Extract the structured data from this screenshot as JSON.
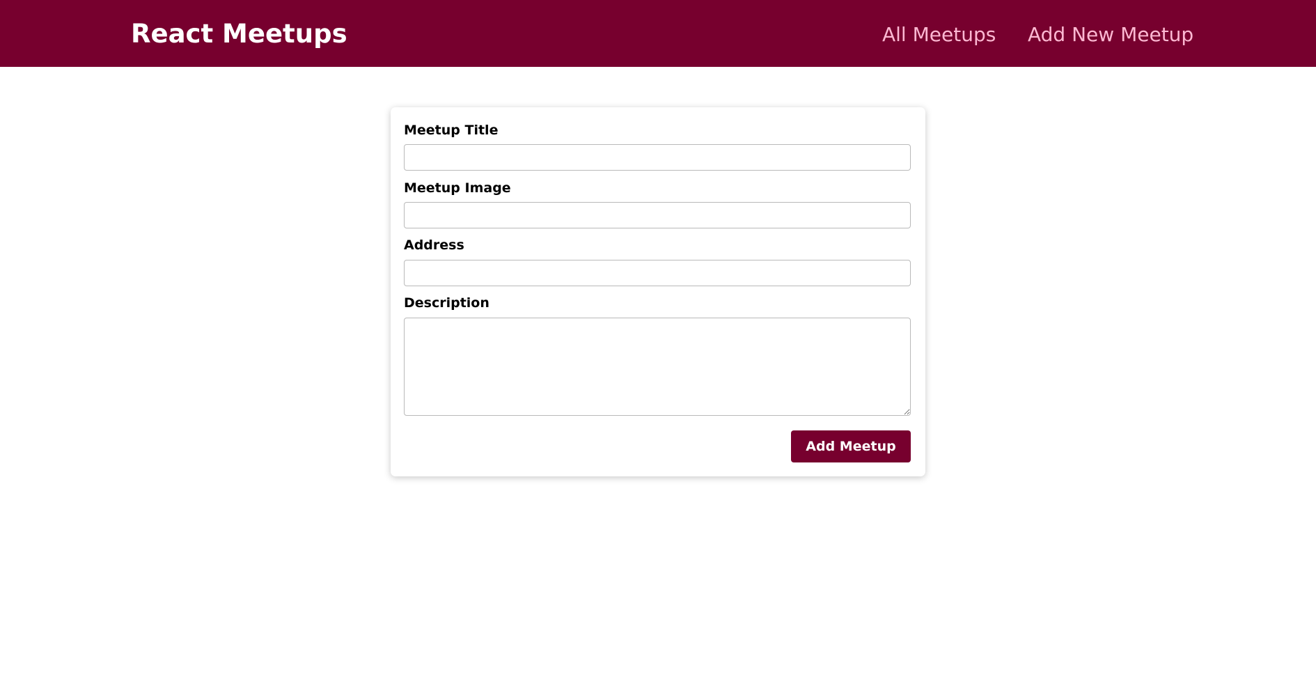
{
  "header": {
    "logo": "React Meetups",
    "nav": {
      "all_meetups": "All Meetups",
      "add_new_meetup": "Add New Meetup"
    }
  },
  "form": {
    "title_label": "Meetup Title",
    "title_value": "",
    "image_label": "Meetup Image",
    "image_value": "",
    "address_label": "Address",
    "address_value": "",
    "description_label": "Description",
    "description_value": "",
    "submit_label": "Add Meetup"
  },
  "colors": {
    "brand": "#77002e",
    "nav_link": "#fcb8d2",
    "background": "#ffffff"
  }
}
